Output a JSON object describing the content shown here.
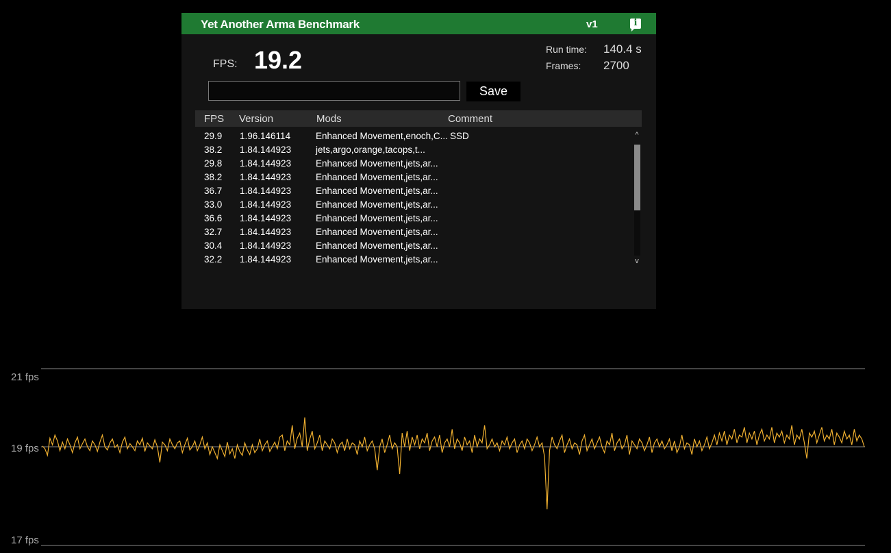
{
  "window": {
    "title": "Yet Another Arma Benchmark",
    "version": "v1",
    "info_icon": "info-speech-bubble-icon",
    "accent_color": "#1f7a32"
  },
  "current": {
    "fps_label": "FPS:",
    "fps_value": "19.2",
    "run_time_label": "Run time:",
    "run_time_value": "140.4 s",
    "frames_label": "Frames:",
    "frames_value": "2700"
  },
  "comment_input": {
    "value": "",
    "placeholder": ""
  },
  "save_button": {
    "label": "Save"
  },
  "table": {
    "headers": [
      "FPS",
      "Version",
      "Mods",
      "Comment"
    ],
    "rows": [
      {
        "fps": "29.9",
        "version": "1.96.146114",
        "mods": "Enhanced Movement,enoch,C...",
        "comment": "SSD"
      },
      {
        "fps": "38.2",
        "version": "1.84.144923",
        "mods": "jets,argo,orange,tacops,t...",
        "comment": ""
      },
      {
        "fps": "29.8",
        "version": "1.84.144923",
        "mods": "Enhanced Movement,jets,ar...",
        "comment": ""
      },
      {
        "fps": "38.2",
        "version": "1.84.144923",
        "mods": "Enhanced Movement,jets,ar...",
        "comment": ""
      },
      {
        "fps": "36.7",
        "version": "1.84.144923",
        "mods": "Enhanced Movement,jets,ar...",
        "comment": ""
      },
      {
        "fps": "33.0",
        "version": "1.84.144923",
        "mods": "Enhanced Movement,jets,ar...",
        "comment": ""
      },
      {
        "fps": "36.6",
        "version": "1.84.144923",
        "mods": "Enhanced Movement,jets,ar...",
        "comment": ""
      },
      {
        "fps": "32.7",
        "version": "1.84.144923",
        "mods": "Enhanced Movement,jets,ar...",
        "comment": ""
      },
      {
        "fps": "30.4",
        "version": "1.84.144923",
        "mods": "Enhanced Movement,jets,ar...",
        "comment": ""
      },
      {
        "fps": "32.2",
        "version": "1.84.144923",
        "mods": "Enhanced Movement,jets,ar...",
        "comment": ""
      }
    ],
    "scroll_up_icon": "^",
    "scroll_down_icon": "v"
  },
  "chart_data": {
    "type": "line",
    "title": "",
    "xlabel": "",
    "ylabel": "",
    "yticks": [
      "21 fps",
      "19 fps",
      "17 fps"
    ],
    "ylim": [
      17,
      21
    ],
    "grid": true,
    "line_color": "#f0b030",
    "series": [
      {
        "values": [
          19.02,
          18.95,
          18.78,
          19.22,
          19.05,
          19.3,
          19.15,
          18.9,
          19.12,
          18.95,
          19.2,
          19.05,
          18.85,
          19.1,
          19.25,
          18.95,
          19.08,
          19.2,
          19.0,
          18.9,
          19.15,
          19.05,
          18.88,
          19.12,
          19.3,
          19.0,
          18.92,
          19.1,
          19.2,
          18.98,
          19.05,
          18.85,
          19.12,
          19.25,
          18.95,
          19.08,
          19.0,
          18.9,
          19.15,
          19.05,
          19.22,
          18.88,
          19.1,
          19.02,
          18.95,
          19.18,
          19.0,
          18.6,
          19.12,
          19.05,
          18.9,
          19.2,
          19.05,
          18.95,
          19.1,
          19.15,
          18.85,
          19.05,
          19.22,
          18.92,
          19.0,
          19.15,
          18.9,
          19.05,
          19.25,
          18.95,
          19.1,
          18.8,
          19.0,
          18.85,
          18.7,
          19.05,
          18.9,
          18.75,
          19.12,
          18.82,
          18.95,
          18.7,
          19.05,
          18.88,
          18.78,
          19.1,
          18.92,
          18.8,
          19.05,
          18.85,
          18.95,
          19.2,
          18.9,
          19.05,
          19.15,
          18.88,
          19.0,
          19.12,
          18.95,
          19.25,
          19.3,
          18.9,
          19.15,
          19.05,
          19.55,
          18.95,
          19.22,
          19.35,
          19.0,
          19.75,
          18.9,
          19.2,
          19.4,
          18.95,
          19.1,
          19.3,
          18.9,
          19.15,
          19.05,
          18.95,
          19.2,
          19.1,
          18.85,
          19.05,
          19.12,
          18.9,
          19.2,
          18.95,
          19.1,
          19.05,
          18.8,
          19.15,
          19.0,
          19.25,
          18.9,
          19.05,
          19.15,
          18.95,
          18.4,
          19.0,
          19.2,
          18.85,
          19.05,
          19.3,
          18.95,
          19.1,
          19.0,
          18.3,
          19.35,
          19.0,
          19.4,
          18.9,
          19.25,
          19.05,
          19.3,
          18.95,
          19.2,
          19.1,
          19.35,
          18.9,
          19.15,
          19.25,
          19.0,
          19.3,
          18.85,
          19.1,
          19.2,
          19.0,
          19.45,
          18.95,
          19.2,
          19.1,
          18.9,
          19.25,
          19.05,
          19.15,
          18.85,
          19.3,
          19.0,
          19.2,
          19.1,
          19.55,
          18.95,
          19.05,
          19.2,
          19.0,
          19.1,
          18.9,
          19.15,
          19.05,
          19.25,
          18.95,
          19.1,
          19.2,
          18.85,
          19.05,
          19.15,
          18.95,
          19.2,
          19.1,
          18.9,
          19.05,
          19.25,
          19.0,
          19.1,
          18.75,
          17.4,
          18.9,
          19.25,
          19.05,
          18.95,
          19.15,
          19.3,
          18.85,
          19.05,
          19.2,
          18.95,
          19.1,
          19.05,
          18.8,
          19.15,
          19.3,
          18.9,
          19.05,
          19.2,
          18.95,
          19.1,
          19.25,
          19.0,
          18.85,
          19.15,
          19.05,
          19.35,
          18.9,
          19.1,
          19.2,
          18.95,
          19.05,
          19.3,
          18.8,
          19.15,
          19.05,
          18.95,
          19.2,
          19.1,
          18.9,
          19.05,
          19.25,
          18.85,
          19.1,
          19.2,
          19.0,
          19.15,
          18.95,
          19.05,
          19.2,
          18.9,
          19.15,
          18.85,
          19.0,
          19.3,
          18.95,
          19.1,
          19.05,
          18.8,
          19.2,
          19.0,
          19.15,
          18.9,
          19.05,
          19.25,
          18.95,
          19.1,
          19.3,
          19.05,
          19.35,
          19.15,
          19.4,
          19.05,
          19.3,
          19.2,
          19.45,
          19.1,
          19.3,
          19.25,
          19.5,
          19.1,
          19.35,
          19.2,
          19.4,
          19.05,
          19.3,
          19.45,
          19.15,
          19.3,
          19.2,
          19.5,
          19.1,
          19.35,
          19.25,
          19.4,
          19.1,
          19.3,
          19.2,
          19.55,
          19.05,
          19.3,
          19.2,
          19.45,
          19.1,
          18.7,
          19.35,
          19.25,
          19.4,
          19.1,
          19.3,
          19.5,
          19.15,
          19.3,
          19.2,
          19.45,
          19.05,
          19.35,
          19.25,
          19.1,
          19.4,
          19.2,
          19.3,
          19.05,
          19.45,
          19.15,
          19.3,
          19.2,
          19.0
        ]
      }
    ]
  }
}
